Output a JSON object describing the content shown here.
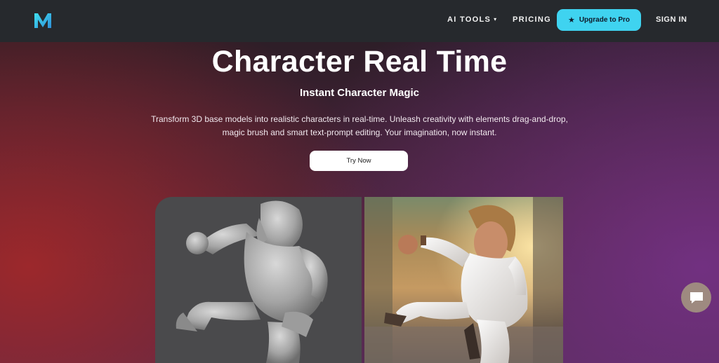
{
  "header": {
    "logo_letter": "M",
    "nav": {
      "ai_tools": "AI TOOLS",
      "pricing": "PRICING",
      "sign_in": "SIGN IN"
    },
    "upgrade_label": "Upgrade to Pro"
  },
  "hero": {
    "title": "Character Real Time",
    "subtitle": "Instant Character Magic",
    "description": "Transform 3D base models into realistic characters in real-time. Unleash creativity with elements drag-and-drop, magic brush and smart text-prompt editing. Your imagination, now instant.",
    "cta": "Try Now"
  },
  "colors": {
    "header_bg": "#26292d",
    "accent": "#3fd3f0",
    "logo_gradient_start": "#3fd3f0",
    "logo_gradient_end": "#2f8fd8"
  },
  "icons": {
    "logo": "brand-m-logo",
    "caret": "chevron-down-icon",
    "upgrade": "star-icon",
    "chat": "chat-bubble-icon"
  }
}
